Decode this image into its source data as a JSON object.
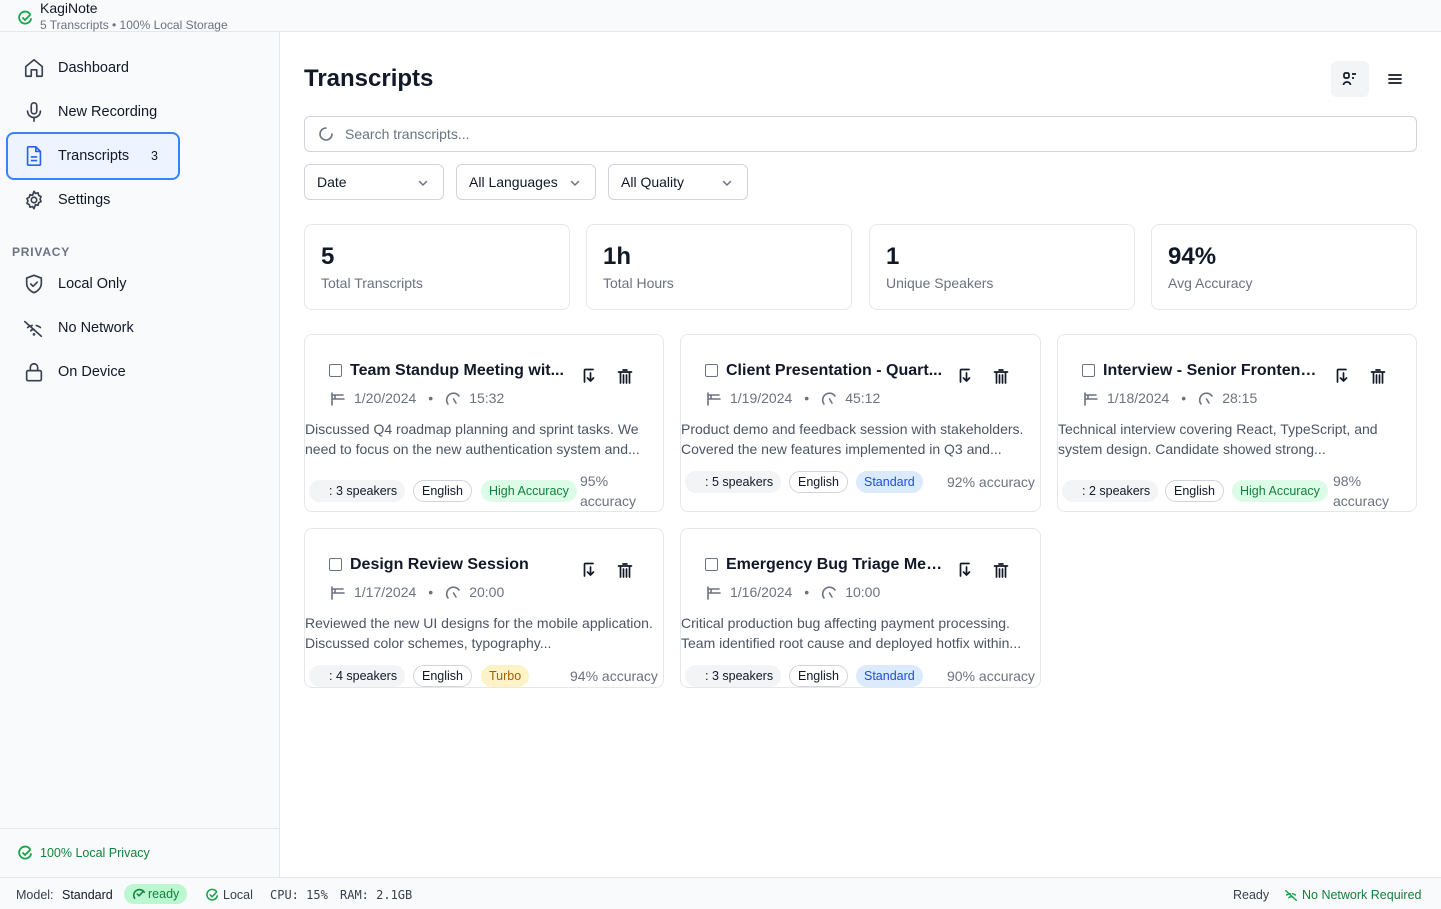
{
  "app": {
    "title": "KagiNote",
    "subtitle": "5 Transcripts • 100% Local Storage"
  },
  "sidebar": {
    "items": [
      {
        "label": "Dashboard",
        "icon": "home-icon"
      },
      {
        "label": "New Recording",
        "icon": "microphone-icon"
      },
      {
        "label": "Transcripts",
        "icon": "document-icon",
        "badge": "3",
        "active": true
      },
      {
        "label": "Settings",
        "icon": "gear-icon"
      }
    ],
    "privacy_heading": "PRIVACY",
    "privacy_items": [
      {
        "label": "Local Only",
        "icon": "shield-icon"
      },
      {
        "label": "No Network",
        "icon": "no-network-icon"
      },
      {
        "label": "On Device",
        "icon": "lock-icon"
      }
    ],
    "footer": "100% Local Privacy"
  },
  "main": {
    "title": "Transcripts",
    "search_placeholder": "Search transcripts...",
    "filters": {
      "sort": "Date",
      "language": "All Languages",
      "quality": "All Quality"
    },
    "stats": [
      {
        "value": "5",
        "label": "Total Transcripts"
      },
      {
        "value": "1h",
        "label": "Total Hours"
      },
      {
        "value": "1",
        "label": "Unique Speakers"
      },
      {
        "value": "94%",
        "label": "Avg Accuracy"
      }
    ],
    "transcripts": [
      {
        "title": "Team Standup Meeting wit...",
        "date": "1/20/2024",
        "duration": "15:32",
        "description": "Discussed Q4 roadmap planning and sprint tasks. We need to focus on the new authentication system and...",
        "speakers": ": 3 speakers",
        "language": "English",
        "quality": "High Accuracy",
        "accuracy": "95% accuracy"
      },
      {
        "title": "Client Presentation - Quart...",
        "date": "1/19/2024",
        "duration": "45:12",
        "description": "Product demo and feedback session with stakeholders. Covered the new features implemented in Q3 and...",
        "speakers": ": 5 speakers",
        "language": "English",
        "quality": "Standard",
        "accuracy": "92% accuracy"
      },
      {
        "title": "Interview - Senior Frontend...",
        "date": "1/18/2024",
        "duration": "28:15",
        "description": "Technical interview covering React, TypeScript, and system design. Candidate showed strong...",
        "speakers": ": 2 speakers",
        "language": "English",
        "quality": "High Accuracy",
        "accuracy": "98% accuracy"
      },
      {
        "title": "Design Review Session",
        "date": "1/17/2024",
        "duration": "20:00",
        "description": "Reviewed the new UI designs for the mobile application. Discussed color schemes, typography...",
        "speakers": ": 4 speakers",
        "language": "English",
        "quality": "Turbo",
        "accuracy": "94% accuracy"
      },
      {
        "title": "Emergency Bug Triage Mee...",
        "date": "1/16/2024",
        "duration": "10:00",
        "description": "Critical production bug affecting payment processing. Team identified root cause and deployed hotfix within...",
        "speakers": ": 3 speakers",
        "language": "English",
        "quality": "Standard",
        "accuracy": "90% accuracy"
      }
    ]
  },
  "statusbar": {
    "model_label": "Model:",
    "model_value": "Standard",
    "ready": "ready",
    "local": "Local",
    "cpu": "CPU: 15%",
    "ram": "RAM: 2.1GB",
    "status": "Ready",
    "network": "No Network Required"
  },
  "colors": {
    "accent": "#3b82f6",
    "success": "#16a34a",
    "border": "#e5e7eb"
  }
}
